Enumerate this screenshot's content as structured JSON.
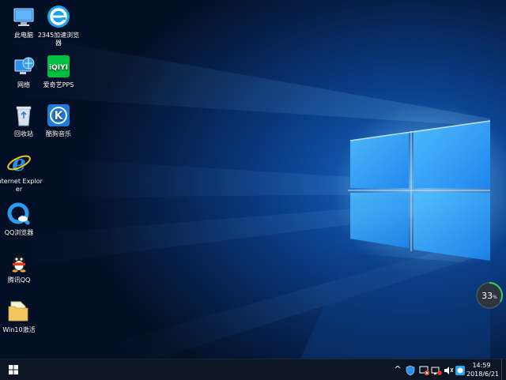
{
  "desktop": {
    "icons": [
      {
        "label": "此电脑",
        "icon": "computer-icon"
      },
      {
        "label": "2345加速浏览器",
        "icon": "2345-browser-icon"
      },
      {
        "label": "网络",
        "icon": "network-icon"
      },
      {
        "label": "爱奇艺PPS",
        "icon": "iqiyi-icon"
      },
      {
        "label": "回收站",
        "icon": "recycle-bin-icon"
      },
      {
        "label": "酷狗音乐",
        "icon": "kugou-icon"
      },
      {
        "label": "Internet Explorer",
        "icon": "ie-icon"
      },
      {
        "label": "QQ浏览器",
        "icon": "qq-browser-icon"
      },
      {
        "label": "腾讯QQ",
        "icon": "qq-icon"
      },
      {
        "label": "Win10激活",
        "icon": "folder-icon"
      }
    ],
    "iqiyi_logo_text": "iQIYI",
    "kugou_logo_text": "K"
  },
  "widget": {
    "progress_value": "33",
    "progress_unit": "%",
    "progress_fraction": 0.33
  },
  "taskbar": {
    "time": "14:59",
    "date": "2018/6/21",
    "tray_chevron": "^"
  },
  "colors": {
    "accent": "#1a8cff",
    "taskbar": "#0b1524",
    "progress": "#3fcf5a"
  }
}
